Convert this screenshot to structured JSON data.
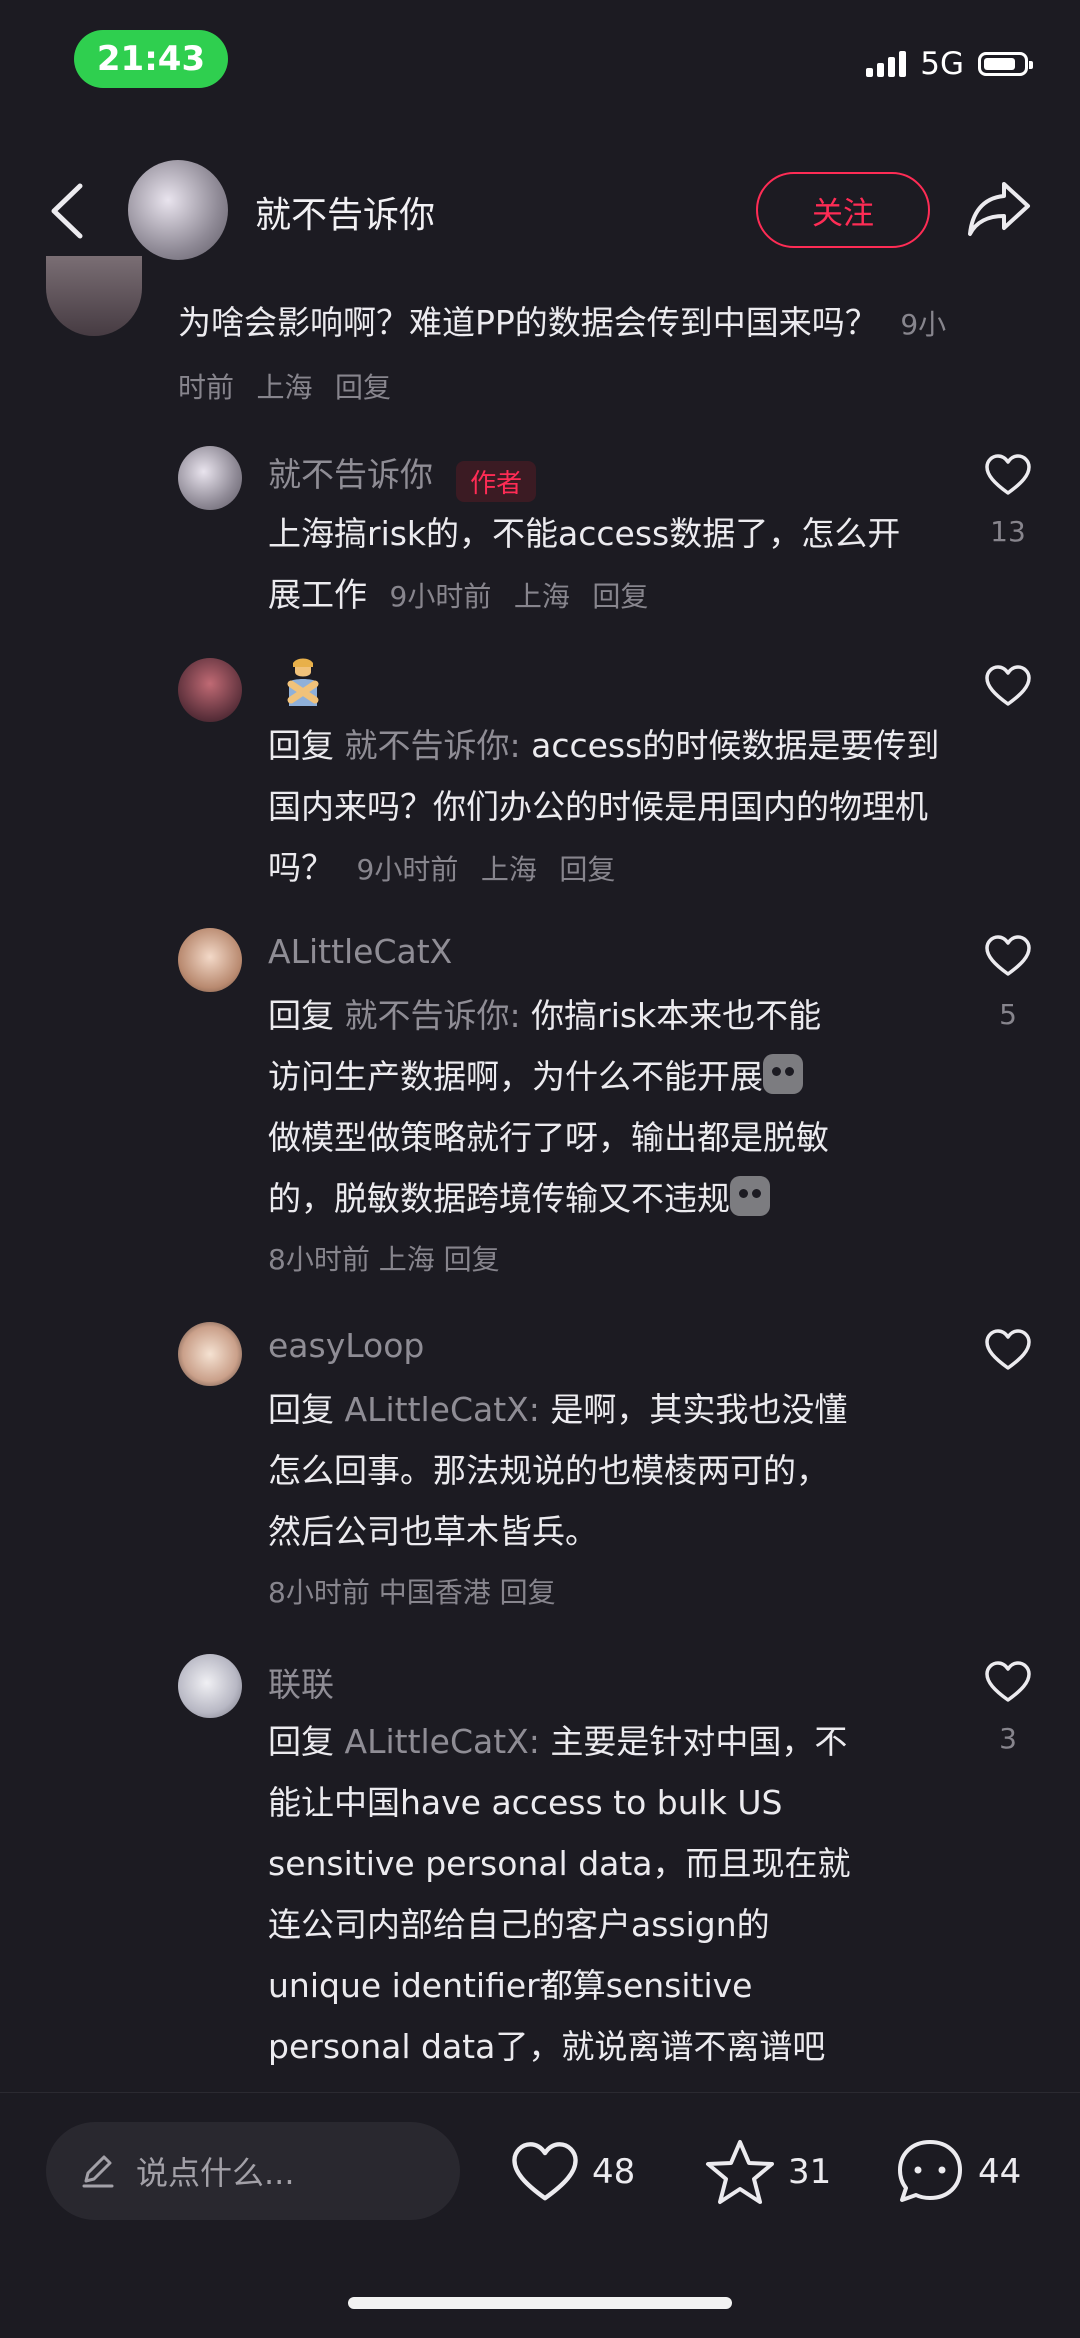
{
  "status_bar": {
    "time": "21:43",
    "network": "5G"
  },
  "header": {
    "username": "就不告诉你",
    "follow_label": "关注"
  },
  "comments": [
    {
      "text": "为啥会影响啊？难道PP的数据会传到中国来吗？",
      "time": "9小时前",
      "location": "上海",
      "reply_label": "回复"
    },
    {
      "username": "就不告诉你",
      "badge": "作者",
      "text": "上海搞risk的，不能access数据了，怎么开展工作",
      "time": "9小时前",
      "location": "上海",
      "reply_label": "回复",
      "likes": "13"
    },
    {
      "reply_prefix": "回复",
      "reply_to": "就不告诉你:",
      "text": "access的时候数据是要传到国内来吗？你们办公的时候是用国内的物理机吗？",
      "time": "9小时前",
      "location": "上海",
      "reply_label": "回复"
    },
    {
      "username": "ALittleCatX",
      "reply_prefix": "回复",
      "reply_to": "就不告诉你:",
      "text_l1": "你搞risk本来也不能",
      "text_l2": "访问生产数据啊，为什么不能开展",
      "text_l3": "做模型做策略就行了呀，输出都是脱敏",
      "text_l4": "的，脱敏数据跨境传输又不违规",
      "time": "8小时前",
      "location": "上海",
      "reply_label": "回复",
      "likes": "5"
    },
    {
      "username": "easyLoop",
      "reply_prefix": "回复",
      "reply_to": "ALittleCatX:",
      "text_l1": "是啊，其实我也没懂",
      "text_l2": "怎么回事。那法规说的也模棱两可的，",
      "text_l3": "然后公司也草木皆兵。",
      "time": "8小时前",
      "location": "中国香港",
      "reply_label": "回复"
    },
    {
      "username": "联联",
      "reply_prefix": "回复",
      "reply_to": "ALittleCatX:",
      "text_l1": "主要是针对中国，不",
      "text_l2": "能让中国have access to bulk US",
      "text_l3": "sensitive personal data，而且现在就",
      "text_l4": "连公司内部给自己的客户assign的",
      "text_l5": "unique identifier都算sensitive",
      "text_l6": "personal data了，就说离谱不离谱吧",
      "likes": "3"
    }
  ],
  "bottom_bar": {
    "input_placeholder": "说点什么...",
    "likes": "48",
    "favorites": "31",
    "comments": "44"
  }
}
